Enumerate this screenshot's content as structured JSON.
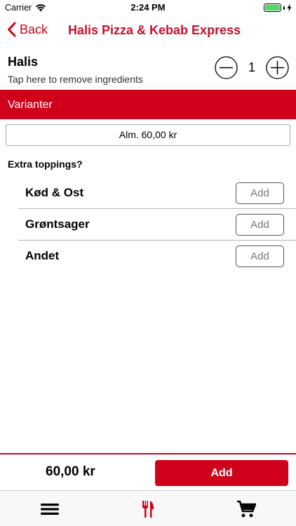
{
  "status_bar": {
    "carrier": "Carrier",
    "time": "2:24 PM"
  },
  "nav": {
    "back_label": "Back",
    "title": "Halis Pizza & Kebab Express"
  },
  "product": {
    "name": "Halis",
    "ingredients_hint": "Tap here to remove ingredients",
    "quantity": "1"
  },
  "variants": {
    "header": "Varianter",
    "selected": "Alm.  60,00 kr"
  },
  "extras": {
    "label": "Extra toppings?",
    "items": [
      {
        "name": "Kød & Ost",
        "button": "Add"
      },
      {
        "name": "Grøntsager",
        "button": "Add"
      },
      {
        "name": "Andet",
        "button": "Add"
      }
    ]
  },
  "order": {
    "total": "60,00 kr",
    "add_label": "Add"
  },
  "tabs": [
    {
      "icon": "menu-icon"
    },
    {
      "icon": "restaurant-icon",
      "active": true
    },
    {
      "icon": "cart-icon"
    }
  ],
  "colors": {
    "accent": "#d0021b",
    "battery": "#4cd964"
  }
}
